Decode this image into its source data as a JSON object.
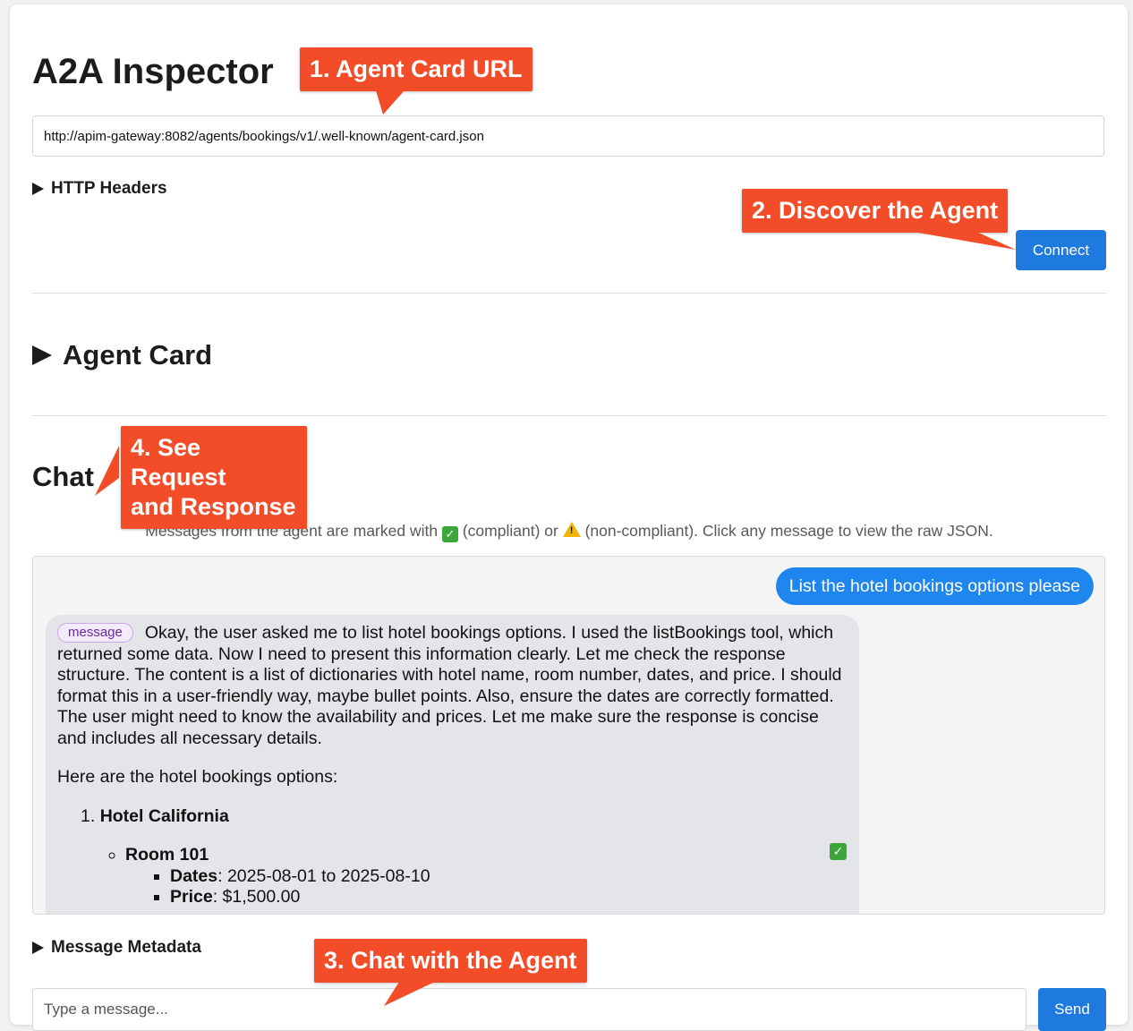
{
  "app": {
    "title": "A2A Inspector"
  },
  "connection": {
    "url_value": "http://apim-gateway:8082/agents/bookings/v1/.well-known/agent-card.json",
    "http_headers_label": "HTTP Headers",
    "connect_label": "Connect"
  },
  "agent_card": {
    "label": "Agent Card"
  },
  "chat": {
    "heading": "Chat",
    "hint_prefix": "Messages from the agent are marked with",
    "hint_compliant": "(compliant) or",
    "hint_noncompliant": "(non-compliant). Click any message to view the raw JSON.",
    "user_message": "List the hotel bookings options please",
    "agent_message": {
      "badge": "message",
      "paragraph1": "Okay, the user asked me to list hotel bookings options. I used the listBookings tool, which returned some data. Now I need to present this information clearly. Let me check the response structure. The content is a list of dictionaries with hotel name, room number, dates, and price. I should format this in a user-friendly way, maybe bullet points. Also, ensure the dates are correctly formatted. The user might need to know the availability and prices. Let me make sure the response is concise and includes all necessary details.",
      "paragraph2": "Here are the hotel bookings options:",
      "hotel_number": "1.",
      "hotel_name": "Hotel California",
      "room": "Room 101",
      "dates_label": "Dates",
      "dates_value": ": 2025-08-01 to 2025-08-10",
      "price_label": "Price",
      "price_value": ": $1,500.00",
      "status_icon": "check-mark-icon"
    },
    "metadata_label": "Message Metadata",
    "input_placeholder": "Type a message...",
    "send_label": "Send"
  },
  "callouts": {
    "step1": "1. Agent Card URL",
    "step2": "2. Discover the Agent",
    "step3": "3. Chat with the Agent",
    "step4_line1": "4. See Request",
    "step4_line2": "and Response"
  },
  "colors": {
    "accent": "#1f7ae0",
    "user_bubble": "#1f86f0",
    "callout": "#f24d28",
    "compliant": "#3ca63a",
    "warning": "#f2b400"
  }
}
